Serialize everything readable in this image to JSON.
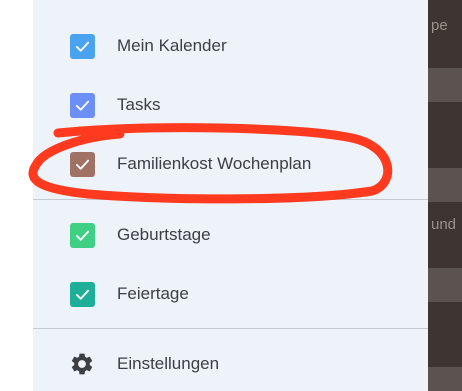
{
  "background": {
    "fragments": [
      "pe",
      "und"
    ]
  },
  "calendars": [
    {
      "label": "Mein Kalender",
      "color": "#4aa3ef",
      "checked": true
    },
    {
      "label": "Tasks",
      "color": "#6b8ff7",
      "checked": true
    },
    {
      "label": "Familienkost Wochenplan",
      "color": "#a07265",
      "checked": true
    },
    {
      "label": "Geburtstage",
      "color": "#3fcf85",
      "checked": true
    },
    {
      "label": "Feiertage",
      "color": "#1fae98",
      "checked": true
    }
  ],
  "settings": {
    "label": "Einstellungen",
    "icon": "gear-icon"
  },
  "annotation": {
    "color": "#ff3a1f",
    "highlighted_item": "Familienkost Wochenplan"
  }
}
